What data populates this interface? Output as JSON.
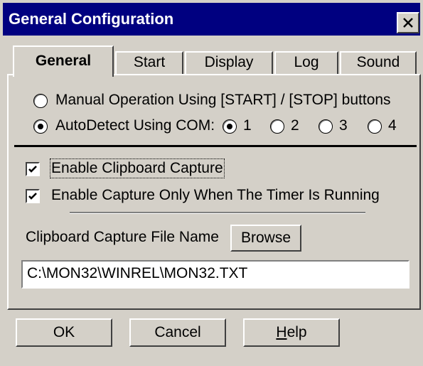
{
  "window": {
    "title": "General Configuration",
    "close_icon": "close-icon"
  },
  "tabs": [
    {
      "label": "General",
      "active": true
    },
    {
      "label": "Start",
      "active": false
    },
    {
      "label": "Display",
      "active": false
    },
    {
      "label": "Log",
      "active": false
    },
    {
      "label": "Sound",
      "active": false
    }
  ],
  "mode": {
    "manual_label": "Manual Operation Using [START] / [STOP] buttons",
    "auto_label": "AutoDetect Using COM:",
    "selected": "auto",
    "com_ports": [
      {
        "label": "1",
        "checked": true
      },
      {
        "label": "2",
        "checked": false
      },
      {
        "label": "3",
        "checked": false
      },
      {
        "label": "4",
        "checked": false
      }
    ]
  },
  "capture": {
    "enable_clipboard_label": "Enable Clipboard Capture",
    "enable_clipboard_checked": true,
    "enable_timer_label": "Enable Capture Only When The Timer Is Running",
    "enable_timer_checked": true,
    "file_name_label": "Clipboard Capture File Name",
    "browse_label": "Browse",
    "file_path": "C:\\MON32\\WINREL\\MON32.TXT"
  },
  "buttons": {
    "ok": "OK",
    "cancel": "Cancel",
    "help_prefix": "H",
    "help_rest": "elp"
  }
}
